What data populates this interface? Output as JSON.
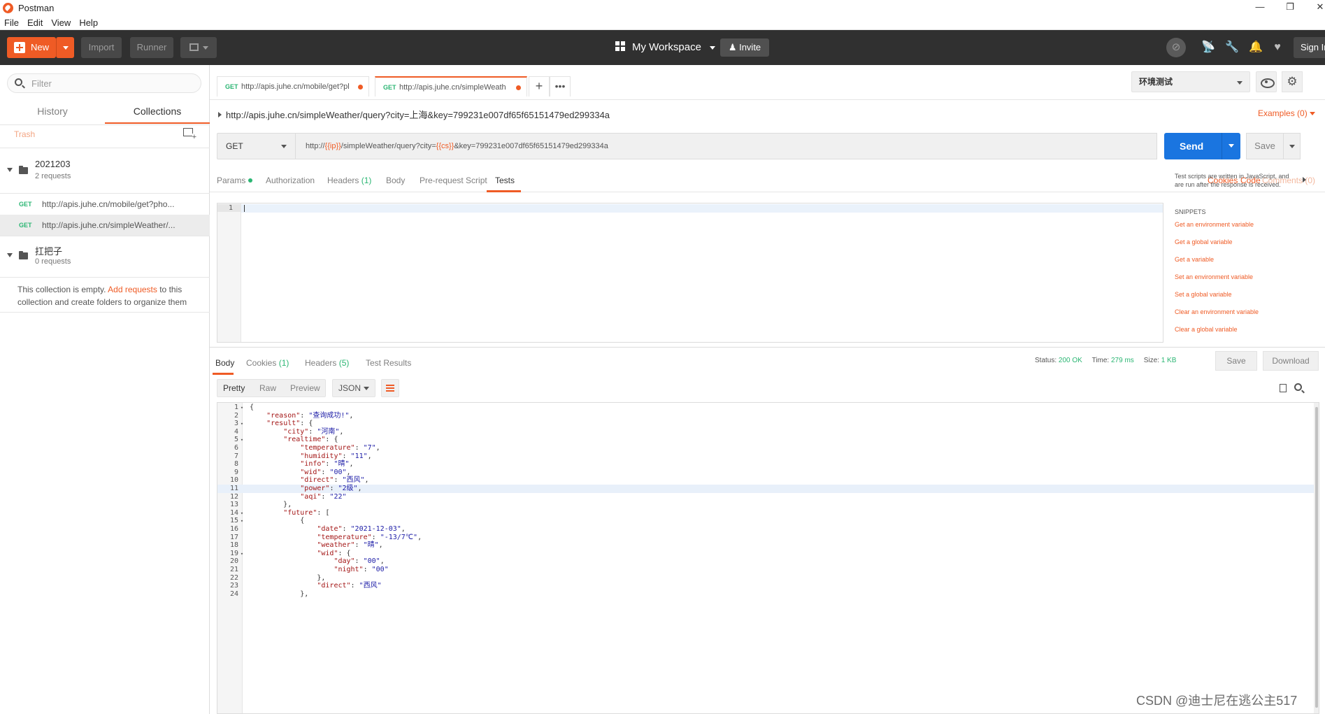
{
  "app": {
    "title": "Postman"
  },
  "window_controls": [
    "—",
    "❐",
    "✕"
  ],
  "menu": [
    "File",
    "Edit",
    "View",
    "Help"
  ],
  "toolbar": {
    "new_label": "New",
    "import_label": "Import",
    "runner_label": "Runner",
    "workspace_label": "My Workspace",
    "invite_label": "Invite",
    "signin_label": "Sign In"
  },
  "sidebar": {
    "filter_placeholder": "Filter",
    "tabs": [
      "History",
      "Collections"
    ],
    "active_tab": "Collections",
    "trash_label": "Trash",
    "collections": [
      {
        "name": "2021203",
        "count": "2 requests",
        "requests": [
          {
            "method": "GET",
            "url": "http://apis.juhe.cn/mobile/get?pho..."
          },
          {
            "method": "GET",
            "url": "http://apis.juhe.cn/simpleWeather/..."
          }
        ]
      },
      {
        "name": "扛把子",
        "count": "0 requests"
      }
    ],
    "empty_msg_1": "This collection is empty. ",
    "empty_msg_link": "Add requests",
    "empty_msg_2": " to this collection and create folders to organize them"
  },
  "tabs": [
    {
      "method": "GET",
      "url": "http://apis.juhe.cn/mobile/get?pl"
    },
    {
      "method": "GET",
      "url": "http://apis.juhe.cn/simpleWeath"
    }
  ],
  "environment": {
    "selected": "环境测试"
  },
  "request": {
    "title": "http://apis.juhe.cn/simpleWeather/query?city=上海&key=799231e007df65f65151479ed299334a",
    "examples_label": "Examples (0)",
    "method": "GET",
    "url_prefix": "http://",
    "url_var1": "{{ip}}",
    "url_mid": "/simpleWeather/query?city=",
    "url_var2": "{{cs}}",
    "url_suffix": "&key=799231e007df65f65151479ed299334a",
    "send_label": "Send",
    "save_label": "Save"
  },
  "request_tabs": {
    "params": "Params",
    "authorization": "Authorization",
    "headers": "Headers",
    "headers_count": "(1)",
    "body": "Body",
    "prerequest": "Pre-request Script",
    "tests": "Tests",
    "cookies": "Cookies",
    "code": "Code",
    "comments": "Comments (0)"
  },
  "tests_editor": {
    "line_number": "1"
  },
  "snippets": {
    "description": "Test scripts are written in JavaScript, and are run after the response is received.",
    "header": "SNIPPETS",
    "items": [
      "Get an environment variable",
      "Get a global variable",
      "Get a variable",
      "Set an environment variable",
      "Set a global variable",
      "Clear an environment variable",
      "Clear a global variable"
    ]
  },
  "response": {
    "tabs": {
      "body": "Body",
      "cookies": "Cookies",
      "cookies_count": "(1)",
      "headers": "Headers",
      "headers_count": "(5)",
      "test_results": "Test Results"
    },
    "status_label": "Status:",
    "status_value": "200 OK",
    "time_label": "Time:",
    "time_value": "279 ms",
    "size_label": "Size:",
    "size_value": "1 KB",
    "save_label": "Save",
    "download_label": "Download",
    "formats": [
      "Pretty",
      "Raw",
      "Preview"
    ],
    "format_type": "JSON",
    "lines": [
      "{",
      "    \"reason\": \"查询成功!\",",
      "    \"result\": {",
      "        \"city\": \"河南\",",
      "        \"realtime\": {",
      "            \"temperature\": \"7\",",
      "            \"humidity\": \"11\",",
      "            \"info\": \"晴\",",
      "            \"wid\": \"00\",",
      "            \"direct\": \"西风\",",
      "            \"power\": \"2级\",",
      "            \"aqi\": \"22\"",
      "        },",
      "        \"future\": [",
      "            {",
      "                \"date\": \"2021-12-03\",",
      "                \"temperature\": \"-13/7℃\",",
      "                \"weather\": \"晴\",",
      "                \"wid\": {",
      "                    \"day\": \"00\",",
      "                    \"night\": \"00\"",
      "                },",
      "                \"direct\": \"西风\"",
      "            },"
    ],
    "fold_lines": [
      1,
      3,
      5,
      14,
      15,
      19
    ],
    "highlight_line": 11
  },
  "watermark": "CSDN @迪士尼在逃公主517",
  "colors": {
    "accent": "#ef5b25",
    "send": "#1a75e0",
    "get": "#2bb673",
    "toolbar": "#303030"
  }
}
